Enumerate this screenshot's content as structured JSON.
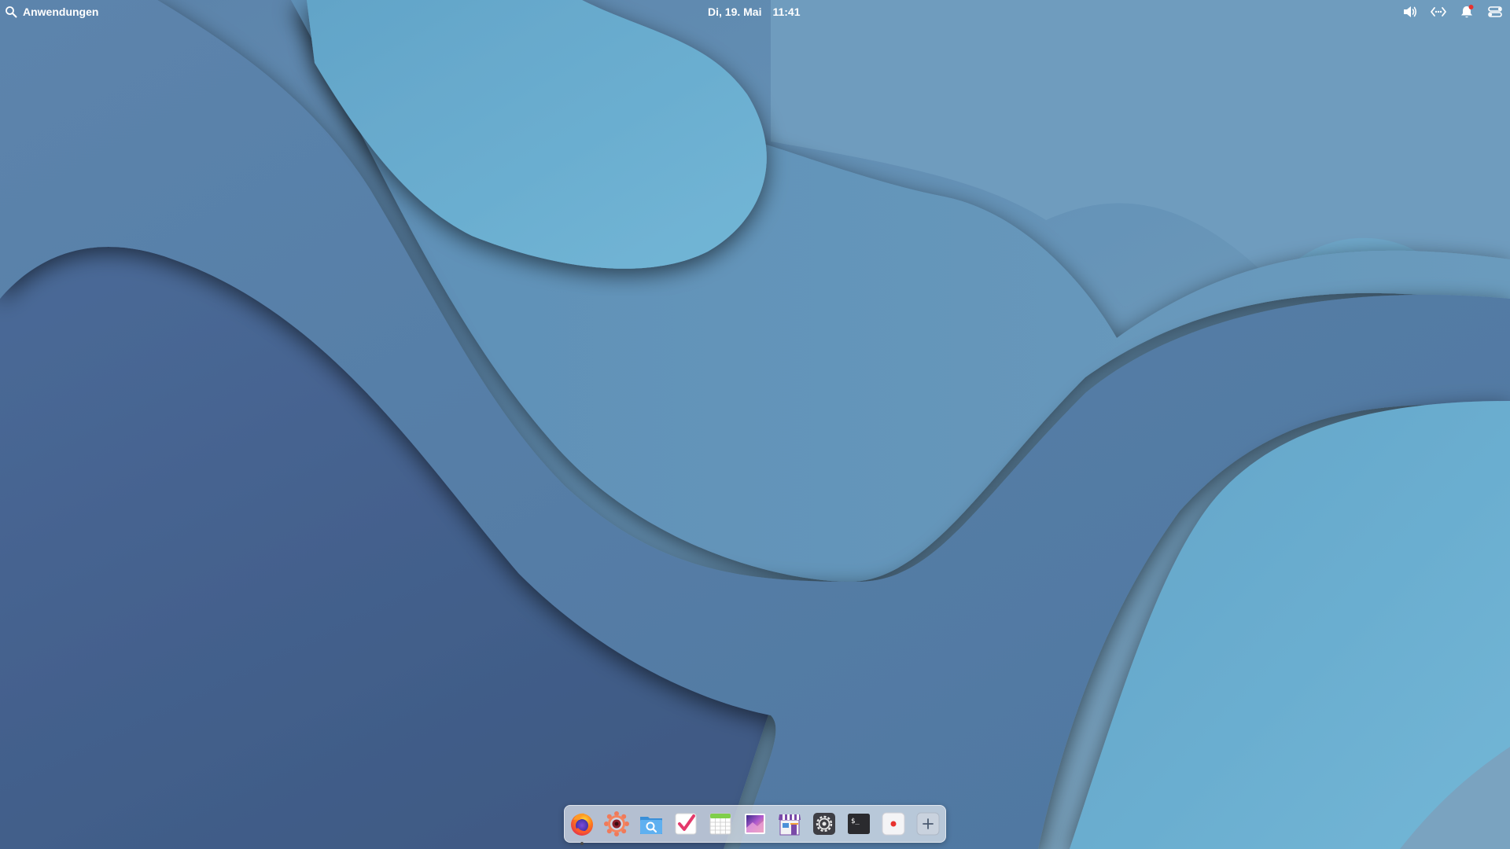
{
  "top_panel": {
    "applications_label": "Anwendungen",
    "date": "Di, 19. Mai",
    "time": "11:41",
    "indicators": [
      {
        "name": "volume-icon"
      },
      {
        "name": "network-wired-icon"
      },
      {
        "name": "notifications-icon",
        "badge_color": "#e8322f"
      },
      {
        "name": "session-menu-icon"
      }
    ]
  },
  "dock": {
    "items": [
      {
        "icon": "firefox-icon",
        "running": true
      },
      {
        "icon": "photobooth-camera-icon",
        "running": false
      },
      {
        "icon": "files-icon",
        "running": false
      },
      {
        "icon": "tasks-icon",
        "running": false
      },
      {
        "icon": "calendar-icon",
        "running": false
      },
      {
        "icon": "photos-icon",
        "running": false
      },
      {
        "icon": "appcenter-icon",
        "running": false
      },
      {
        "icon": "system-settings-icon",
        "running": false
      },
      {
        "icon": "terminal-icon",
        "running": false
      },
      {
        "icon": "screen-recorder-icon",
        "running": false
      },
      {
        "icon": "add-workspace-icon",
        "running": false
      }
    ]
  },
  "colors": {
    "wallpaper_dark": "#3f5788",
    "wallpaper_mid": "#5d88ad",
    "wallpaper_light": "#6bb1d1",
    "panel_text": "#ffffff",
    "notification_badge": "#e8322f"
  }
}
